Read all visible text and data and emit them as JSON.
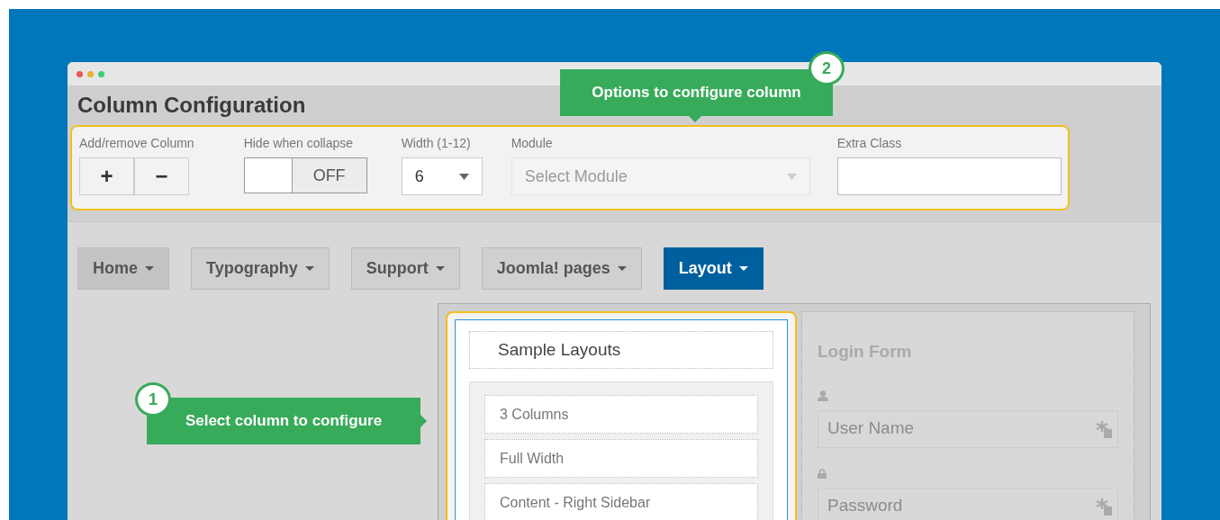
{
  "window": {
    "title": "Column Configuration"
  },
  "callouts": [
    {
      "number": "2",
      "text": "Options to configure column"
    },
    {
      "number": "1",
      "text": "Select column to configure"
    }
  ],
  "config": {
    "fields": [
      {
        "kind": "buttons",
        "label": "Add/remove Column",
        "buttons": [
          "+",
          "−"
        ]
      },
      {
        "kind": "toggle",
        "label": "Hide when collapse",
        "value": "OFF",
        "on": false
      },
      {
        "kind": "select",
        "label": "Width (1-12)",
        "value": "6",
        "disabled": false
      },
      {
        "kind": "select",
        "label": "Module",
        "placeholder": "Select Module",
        "disabled": true
      },
      {
        "kind": "text",
        "label": "Extra Class"
      }
    ]
  },
  "menu": [
    {
      "label": "Home",
      "selected": false
    },
    {
      "label": "Typography",
      "selected": false
    },
    {
      "label": "Support",
      "selected": false
    },
    {
      "label": "Joomla! pages",
      "selected": false
    },
    {
      "label": "Layout",
      "selected": true
    }
  ],
  "columns": [
    {
      "selected": true,
      "module_title": "Sample Layouts",
      "items": [
        "3 Columns",
        "Full Width",
        "Content - Right Sidebar"
      ]
    },
    {
      "selected": false,
      "module_title": "Login Form",
      "fields": [
        {
          "placeholder": "User Name"
        },
        {
          "placeholder": "Password"
        }
      ]
    }
  ]
}
